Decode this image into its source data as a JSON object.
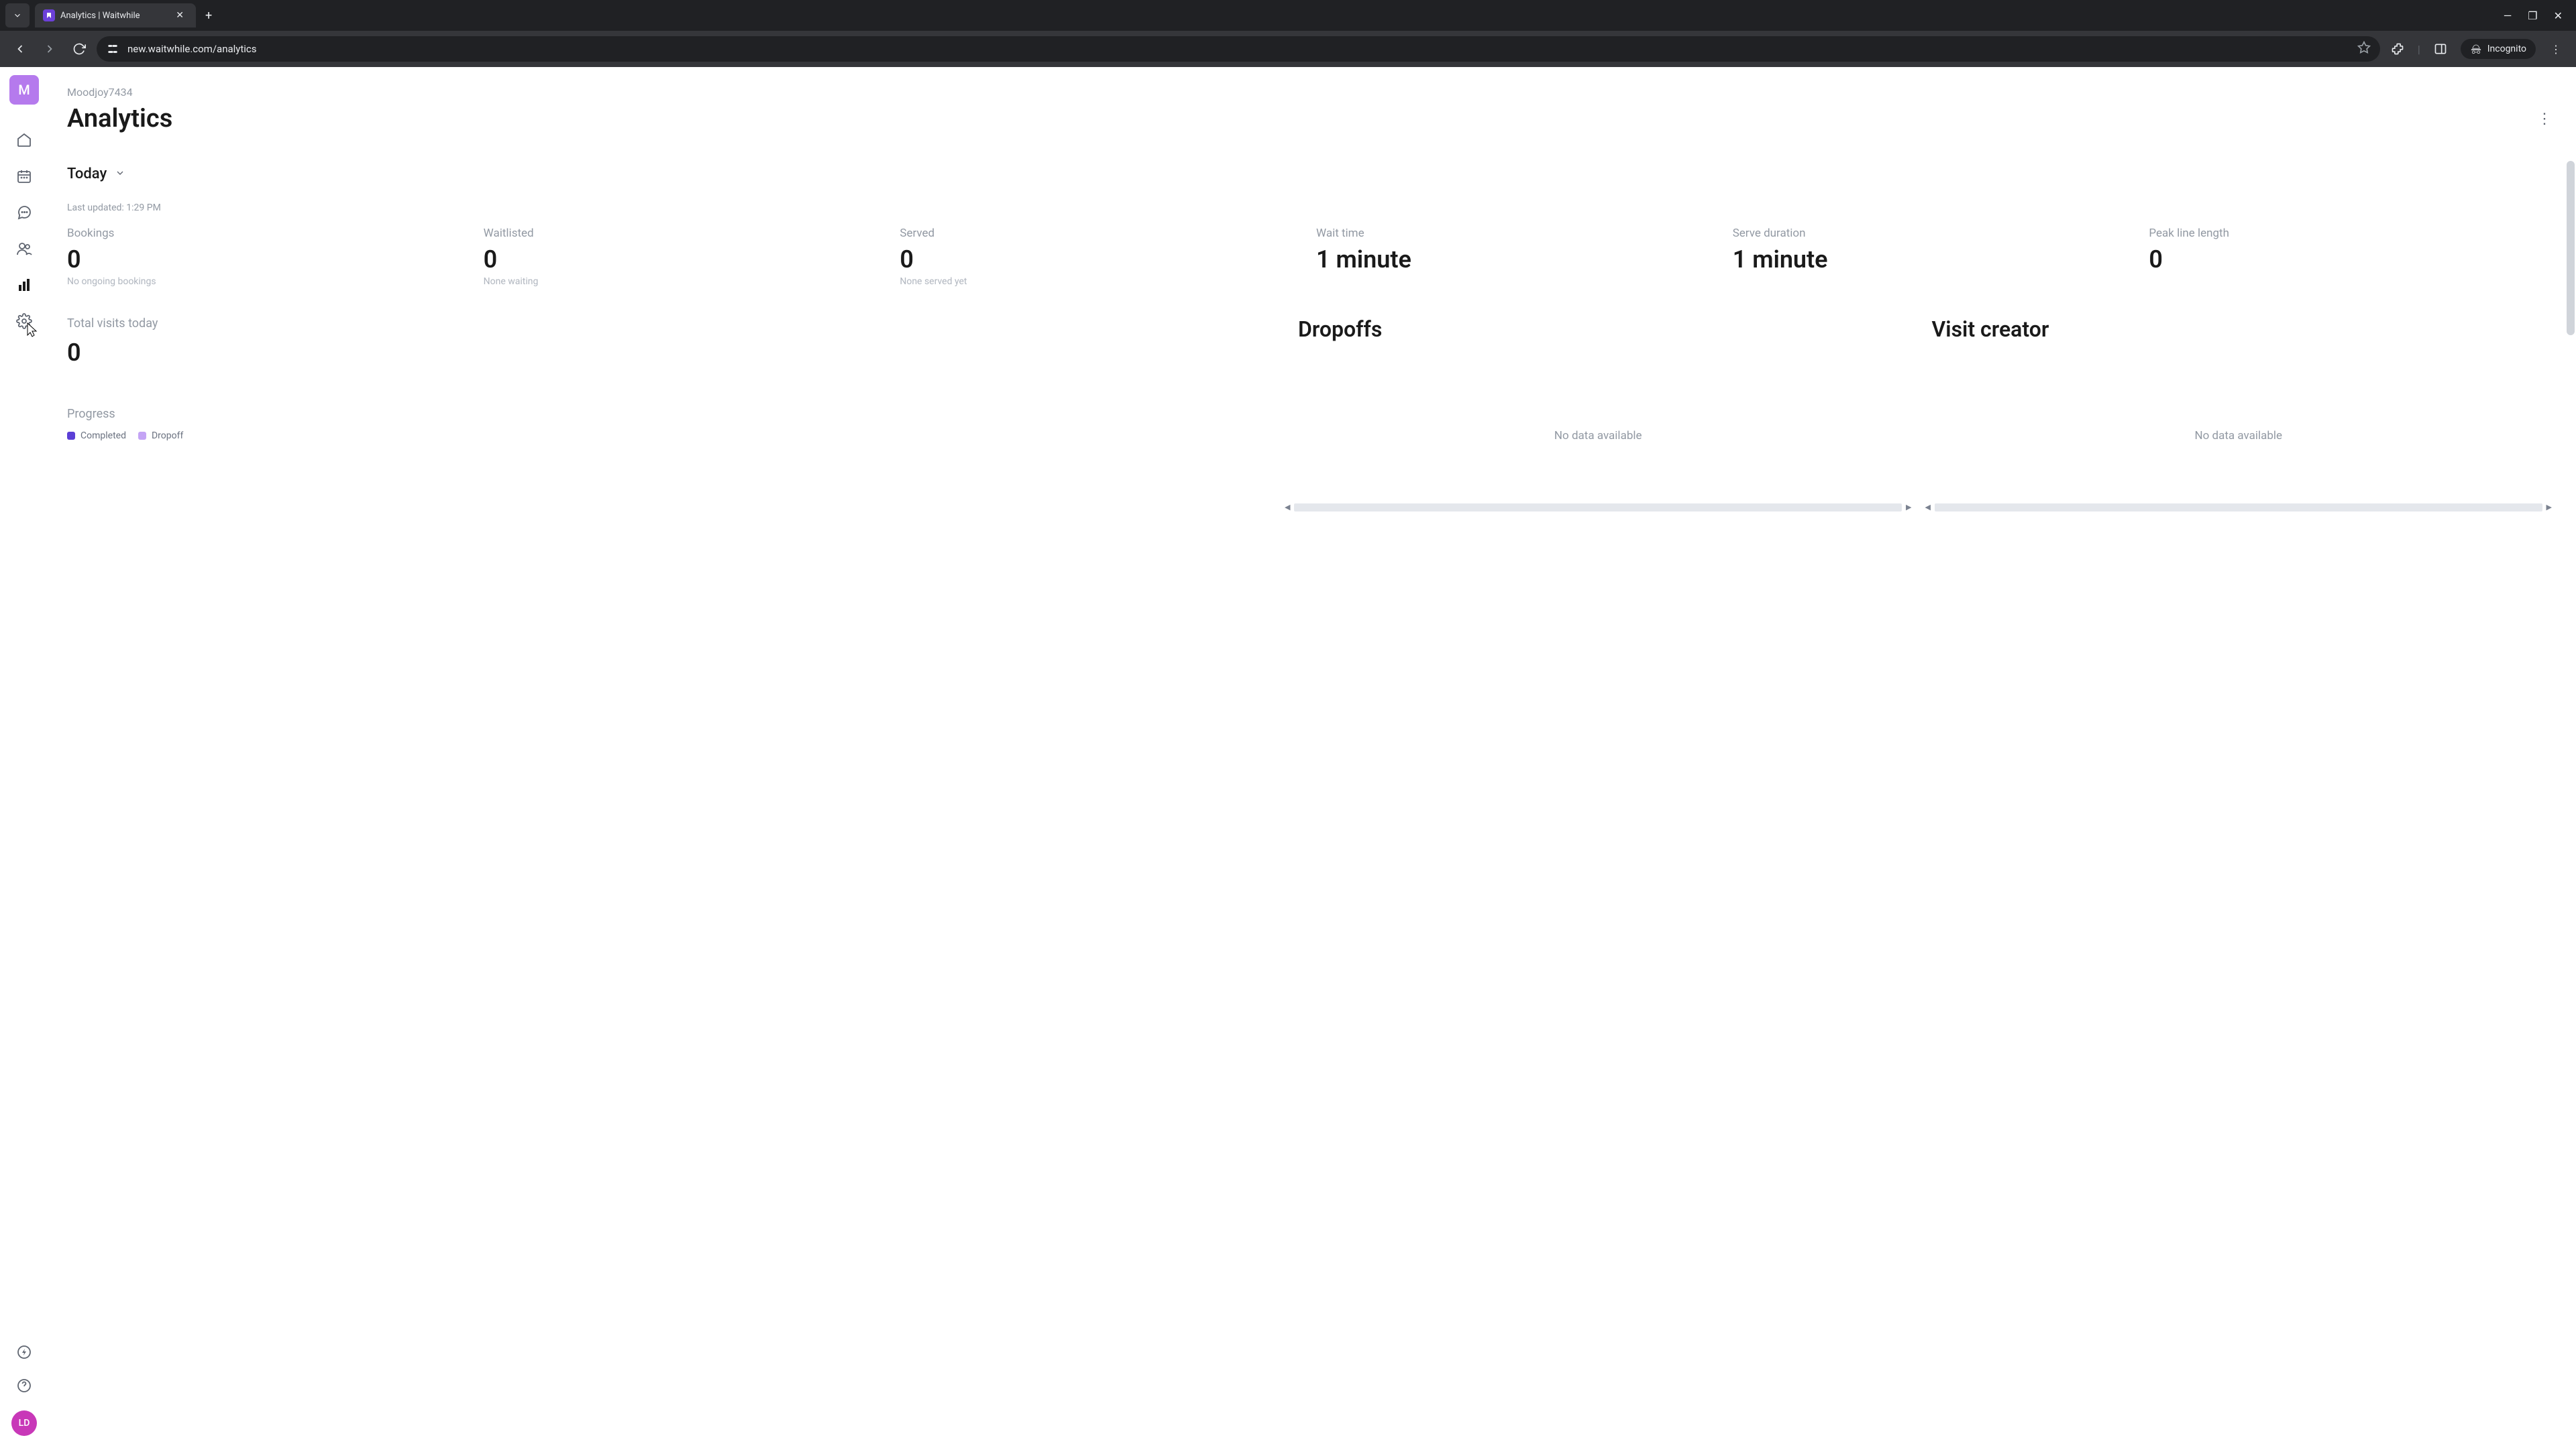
{
  "browser": {
    "tab_title": "Analytics | Waitwhile",
    "url": "new.waitwhile.com/analytics",
    "incognito_label": "Incognito"
  },
  "workspace": {
    "initial": "M",
    "name": "Moodjoy7434"
  },
  "page": {
    "title": "Analytics"
  },
  "date_filter": {
    "label": "Today"
  },
  "last_updated": "Last updated: 1:29 PM",
  "metrics": {
    "bookings": {
      "label": "Bookings",
      "value": "0",
      "sub": "No ongoing bookings"
    },
    "waitlisted": {
      "label": "Waitlisted",
      "value": "0",
      "sub": "None waiting"
    },
    "served": {
      "label": "Served",
      "value": "0",
      "sub": "None served yet"
    },
    "wait_time": {
      "label": "Wait time",
      "value": "1 minute"
    },
    "serve_duration": {
      "label": "Serve duration",
      "value": "1 minute"
    },
    "peak_line": {
      "label": "Peak line length",
      "value": "0"
    }
  },
  "total_visits": {
    "label": "Total visits today",
    "value": "0"
  },
  "panels": {
    "dropoffs": {
      "title": "Dropoffs",
      "nodata": "No data available"
    },
    "visit_creator": {
      "title": "Visit creator",
      "nodata": "No data available"
    }
  },
  "progress": {
    "label": "Progress",
    "legend": {
      "completed": "Completed",
      "dropoff": "Dropoff"
    }
  },
  "user": {
    "initials": "LD"
  }
}
